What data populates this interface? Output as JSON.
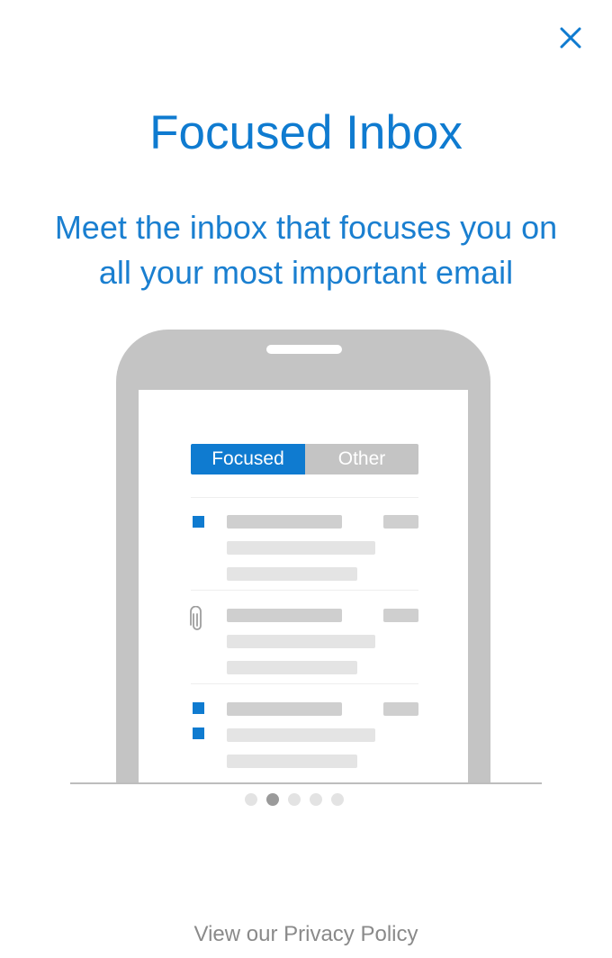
{
  "header": {
    "close_icon": "close-icon",
    "close_color": "#0f7bd0"
  },
  "onboarding": {
    "title": "Focused Inbox",
    "subtitle_line1": "Meet the inbox that focuses you on",
    "subtitle_line2": "all your most important email"
  },
  "illustration": {
    "tabs": [
      {
        "label": "Focused",
        "selected": true
      },
      {
        "label": "Other",
        "selected": false
      }
    ],
    "accent_color": "#0f7bd0",
    "items": [
      {
        "marker": "unread-square-icon"
      },
      {
        "marker": "paperclip-icon"
      },
      {
        "marker": "unread-square-icon"
      }
    ]
  },
  "pager": {
    "page_count": 5,
    "current_page": 2
  },
  "footer": {
    "privacy_link": "View our Privacy Policy"
  }
}
